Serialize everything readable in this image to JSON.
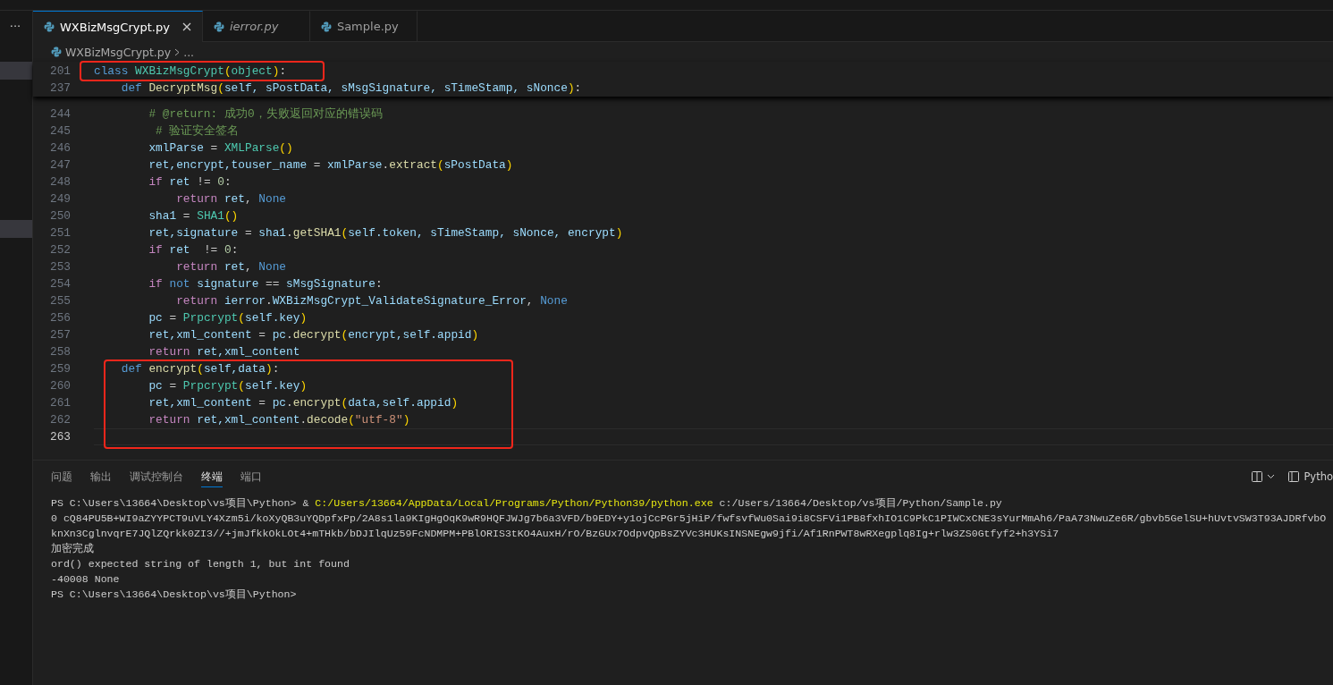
{
  "sidebar": {
    "more_button": "···"
  },
  "tabs": [
    {
      "label": "WXBizMsgCrypt.py",
      "selected": true,
      "preview": false
    },
    {
      "label": "ierror.py",
      "selected": false,
      "preview": true
    },
    {
      "label": "Sample.py",
      "selected": false,
      "preview": false
    }
  ],
  "breadcrumb": [
    "WXBizMsgCrypt.py",
    "..."
  ],
  "sticky_lines": [
    {
      "number": "201",
      "outlined": true,
      "tokens": [
        {
          "kind": "kw",
          "text": "class "
        },
        {
          "kind": "cls",
          "text": "WXBizMsgCrypt"
        },
        {
          "kind": "br",
          "text": "("
        },
        {
          "kind": "cls",
          "text": "object"
        },
        {
          "kind": "br",
          "text": ")"
        },
        {
          "kind": "x",
          "text": ":"
        }
      ]
    },
    {
      "number": "237",
      "outlined": false,
      "tokens": [
        {
          "kind": "kw",
          "text": "    def "
        },
        {
          "kind": "fn",
          "text": "DecryptMsg"
        },
        {
          "kind": "br",
          "text": "("
        },
        {
          "kind": "var",
          "text": "self, sPostData, sMsgSignature, sTimeStamp, sNonce"
        },
        {
          "kind": "br",
          "text": ")"
        },
        {
          "kind": "x",
          "text": ":"
        }
      ]
    }
  ],
  "code_blocks": [
    {
      "outlined": false,
      "lines": [
        {
          "number": "244",
          "current": false,
          "tokens": [
            {
              "kind": "cmt",
              "text": "        # @return: 成功0，失败返回对应的错误码"
            }
          ]
        },
        {
          "number": "245",
          "current": false,
          "tokens": [
            {
              "kind": "cmt",
              "text": "         # 验证安全签名"
            }
          ]
        },
        {
          "number": "246",
          "current": false,
          "tokens": [
            {
              "kind": "var",
              "text": "        xmlParse"
            },
            {
              "kind": "x",
              "text": " = "
            },
            {
              "kind": "cls",
              "text": "XMLParse"
            },
            {
              "kind": "br",
              "text": "()"
            }
          ]
        },
        {
          "number": "247",
          "current": false,
          "tokens": [
            {
              "kind": "var",
              "text": "        ret,encrypt,touser_name"
            },
            {
              "kind": "x",
              "text": " = "
            },
            {
              "kind": "var",
              "text": "xmlParse"
            },
            {
              "kind": "x",
              "text": "."
            },
            {
              "kind": "fn",
              "text": "extract"
            },
            {
              "kind": "br",
              "text": "("
            },
            {
              "kind": "var",
              "text": "sPostData"
            },
            {
              "kind": "br",
              "text": ")"
            }
          ]
        },
        {
          "number": "248",
          "current": false,
          "tokens": [
            {
              "kind": "ctl",
              "text": "        if "
            },
            {
              "kind": "var",
              "text": "ret"
            },
            {
              "kind": "x",
              "text": " != "
            },
            {
              "kind": "num",
              "text": "0"
            },
            {
              "kind": "x",
              "text": ":"
            }
          ]
        },
        {
          "number": "249",
          "current": false,
          "tokens": [
            {
              "kind": "ctl",
              "text": "            return "
            },
            {
              "kind": "var",
              "text": "ret"
            },
            {
              "kind": "x",
              "text": ", "
            },
            {
              "kind": "kw",
              "text": "None"
            }
          ]
        },
        {
          "number": "250",
          "current": false,
          "tokens": [
            {
              "kind": "var",
              "text": "        sha1"
            },
            {
              "kind": "x",
              "text": " = "
            },
            {
              "kind": "cls",
              "text": "SHA1"
            },
            {
              "kind": "br",
              "text": "()"
            }
          ]
        },
        {
          "number": "251",
          "current": false,
          "tokens": [
            {
              "kind": "var",
              "text": "        ret,signature"
            },
            {
              "kind": "x",
              "text": " = "
            },
            {
              "kind": "var",
              "text": "sha1"
            },
            {
              "kind": "x",
              "text": "."
            },
            {
              "kind": "fn",
              "text": "getSHA1"
            },
            {
              "kind": "br",
              "text": "("
            },
            {
              "kind": "var",
              "text": "self.token, sTimeStamp, sNonce, encrypt"
            },
            {
              "kind": "br",
              "text": ")"
            }
          ]
        },
        {
          "number": "252",
          "current": false,
          "tokens": [
            {
              "kind": "ctl",
              "text": "        if "
            },
            {
              "kind": "var",
              "text": "ret"
            },
            {
              "kind": "x",
              "text": "  != "
            },
            {
              "kind": "num",
              "text": "0"
            },
            {
              "kind": "x",
              "text": ":"
            }
          ]
        },
        {
          "number": "253",
          "current": false,
          "tokens": [
            {
              "kind": "ctl",
              "text": "            return "
            },
            {
              "kind": "var",
              "text": "ret"
            },
            {
              "kind": "x",
              "text": ", "
            },
            {
              "kind": "kw",
              "text": "None"
            }
          ]
        },
        {
          "number": "254",
          "current": false,
          "tokens": [
            {
              "kind": "ctl",
              "text": "        if "
            },
            {
              "kind": "kw",
              "text": "not "
            },
            {
              "kind": "var",
              "text": "signature"
            },
            {
              "kind": "x",
              "text": " == "
            },
            {
              "kind": "var",
              "text": "sMsgSignature"
            },
            {
              "kind": "x",
              "text": ":"
            }
          ]
        },
        {
          "number": "255",
          "current": false,
          "tokens": [
            {
              "kind": "ctl",
              "text": "            return "
            },
            {
              "kind": "var",
              "text": "ierror"
            },
            {
              "kind": "x",
              "text": "."
            },
            {
              "kind": "var",
              "text": "WXBizMsgCrypt_ValidateSignature_Error"
            },
            {
              "kind": "x",
              "text": ", "
            },
            {
              "kind": "kw",
              "text": "None"
            }
          ]
        },
        {
          "number": "256",
          "current": false,
          "tokens": [
            {
              "kind": "var",
              "text": "        pc"
            },
            {
              "kind": "x",
              "text": " = "
            },
            {
              "kind": "cls",
              "text": "Prpcrypt"
            },
            {
              "kind": "br",
              "text": "("
            },
            {
              "kind": "var",
              "text": "self.key"
            },
            {
              "kind": "br",
              "text": ")"
            }
          ]
        },
        {
          "number": "257",
          "current": false,
          "tokens": [
            {
              "kind": "var",
              "text": "        ret,xml_content"
            },
            {
              "kind": "x",
              "text": " = "
            },
            {
              "kind": "var",
              "text": "pc"
            },
            {
              "kind": "x",
              "text": "."
            },
            {
              "kind": "fn",
              "text": "decrypt"
            },
            {
              "kind": "br",
              "text": "("
            },
            {
              "kind": "var",
              "text": "encrypt,self.appid"
            },
            {
              "kind": "br",
              "text": ")"
            }
          ]
        },
        {
          "number": "258",
          "current": false,
          "tokens": [
            {
              "kind": "ctl",
              "text": "        return "
            },
            {
              "kind": "var",
              "text": "ret,xml_content"
            }
          ]
        }
      ]
    },
    {
      "outlined": true,
      "lines": [
        {
          "number": "259",
          "current": false,
          "tokens": [
            {
              "kind": "kw",
              "text": "    def "
            },
            {
              "kind": "fn",
              "text": "encrypt"
            },
            {
              "kind": "br",
              "text": "("
            },
            {
              "kind": "var",
              "text": "self,data"
            },
            {
              "kind": "br",
              "text": ")"
            },
            {
              "kind": "x",
              "text": ":"
            }
          ]
        },
        {
          "number": "260",
          "current": false,
          "tokens": [
            {
              "kind": "var",
              "text": "        pc"
            },
            {
              "kind": "x",
              "text": " = "
            },
            {
              "kind": "cls",
              "text": "Prpcrypt"
            },
            {
              "kind": "br",
              "text": "("
            },
            {
              "kind": "var",
              "text": "self.key"
            },
            {
              "kind": "br",
              "text": ")"
            }
          ]
        },
        {
          "number": "261",
          "current": false,
          "tokens": [
            {
              "kind": "var",
              "text": "        ret,xml_content"
            },
            {
              "kind": "x",
              "text": " = "
            },
            {
              "kind": "var",
              "text": "pc"
            },
            {
              "kind": "x",
              "text": "."
            },
            {
              "kind": "fn",
              "text": "encrypt"
            },
            {
              "kind": "br",
              "text": "("
            },
            {
              "kind": "var",
              "text": "data,self.appid"
            },
            {
              "kind": "br",
              "text": ")"
            }
          ]
        },
        {
          "number": "262",
          "current": false,
          "tokens": [
            {
              "kind": "ctl",
              "text": "        return "
            },
            {
              "kind": "var",
              "text": "ret,xml_content"
            },
            {
              "kind": "x",
              "text": "."
            },
            {
              "kind": "fn",
              "text": "decode"
            },
            {
              "kind": "br",
              "text": "("
            },
            {
              "kind": "str",
              "text": "\"utf-8\""
            },
            {
              "kind": "br",
              "text": ")"
            }
          ]
        },
        {
          "number": "263",
          "current": true
        }
      ]
    }
  ],
  "panel": {
    "tabs": [
      {
        "label": "问题",
        "selected": false
      },
      {
        "label": "输出",
        "selected": false
      },
      {
        "label": "调试控制台",
        "selected": false
      },
      {
        "label": "终端",
        "selected": true
      },
      {
        "label": "端口",
        "selected": false
      }
    ],
    "terminal_name": "Pytho",
    "terminal_lines": [
      [
        {
          "kind": "text",
          "text": "PS C:\\Users\\13664\\Desktop\\vs项目\\Python> & "
        },
        {
          "kind": "path",
          "text": "C:/Users/13664/AppData/Local/Programs/Python/Python39/python.exe"
        },
        {
          "kind": "text",
          "text": " c:/Users/13664/Desktop/vs项目/Python/Sample.py"
        }
      ],
      [
        {
          "kind": "text",
          "text": "0 cQ84PU5B+WI9aZYYPCT9uVLY4Xzm5i/koXyQB3uYQDpfxPp/2A8s1la9KIgHgOqK9wR9HQFJWJg7b6a3VFD/b9EDY+y1ojCcPGr5jHiP/fwfsvfWu0Sai9i8CSFVi1PB8fxhIO1C9PkC1PIWCxCNE3sYurMmAh6/PaA73NwuZe6R/gbvb5GelSU+hUvtvSW3T93AJDRfvbO"
        }
      ],
      [
        {
          "kind": "text",
          "text": "knXn3CglnvqrE7JQlZQrkk0ZI3//+jmJfkkOkLOt4+mTHkb/bDJIlqUz59FcNDMPM+PBlORIS3tKO4AuxH/rO/BzGUx7OdpvQpBsZYVc3HUKsINSNEgw9jfi/Af1RnPWT8wRXegplq8Ig+rlw3ZS0Gtfyf2+h3YSi7"
        }
      ],
      [
        {
          "kind": "text",
          "text": "加密完成"
        }
      ],
      [
        {
          "kind": "text",
          "text": "ord() expected string of length 1, but int found"
        }
      ],
      [
        {
          "kind": "text",
          "text": "-40008 None"
        }
      ],
      [
        {
          "kind": "text",
          "text": "PS C:\\Users\\13664\\Desktop\\vs项目\\Python>"
        }
      ]
    ]
  }
}
